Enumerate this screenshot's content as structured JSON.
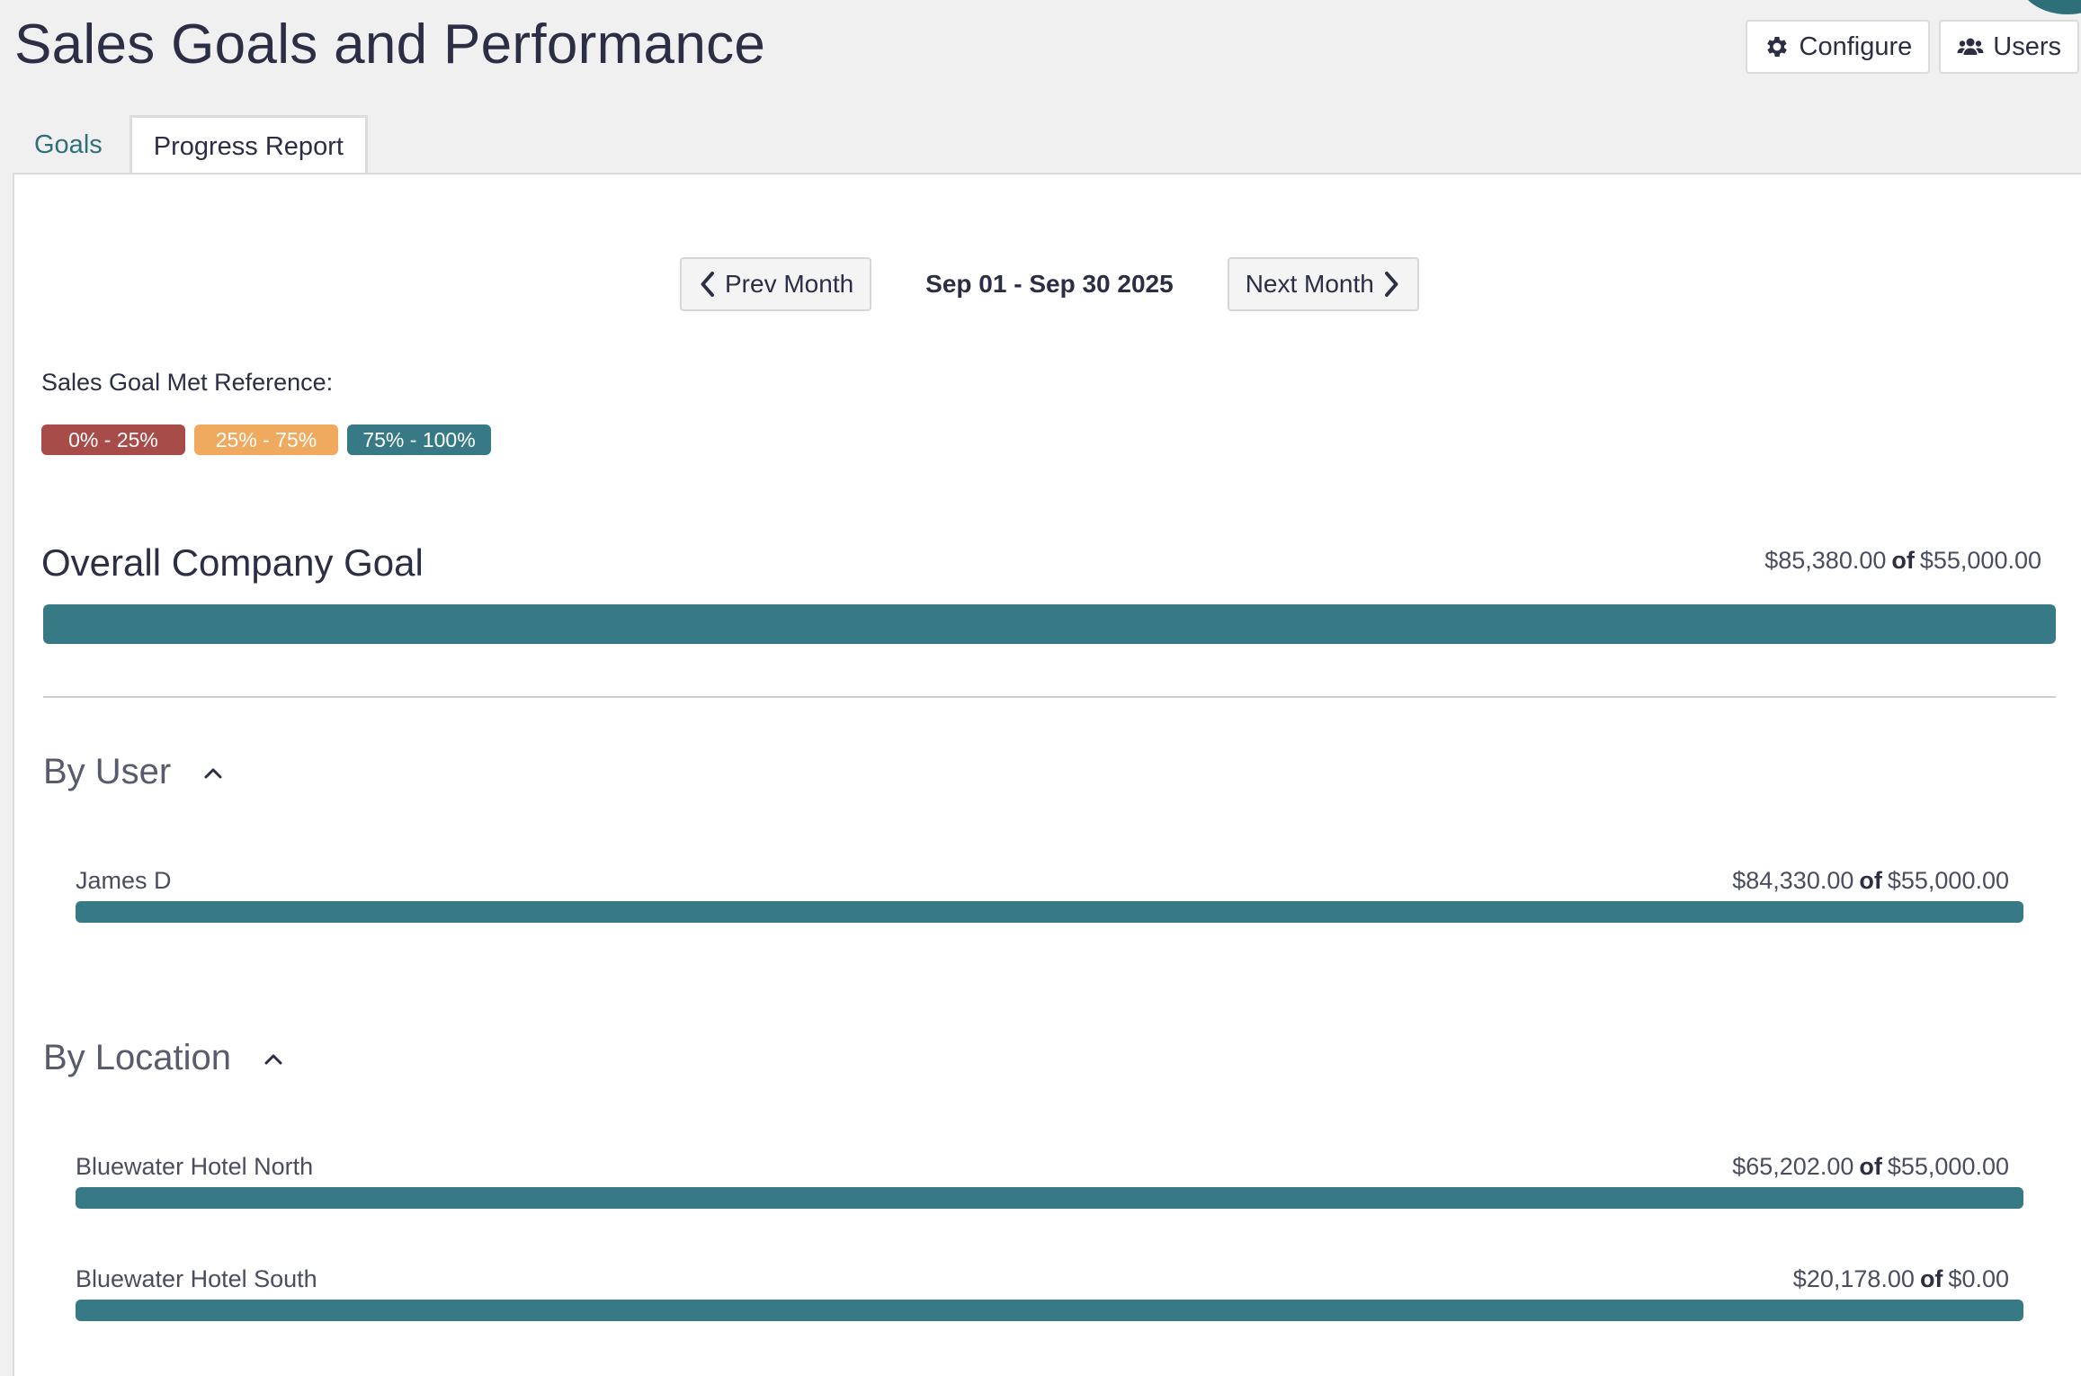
{
  "page": {
    "title": "Sales Goals and Performance"
  },
  "top_actions": {
    "configure_label": "Configure",
    "users_label": "Users"
  },
  "tabs": [
    {
      "label": "Goals",
      "active": false
    },
    {
      "label": "Progress Report",
      "active": true
    }
  ],
  "month_nav": {
    "prev_label": "Prev Month",
    "date_range": "Sep 01 - Sep 30 2025",
    "next_label": "Next Month"
  },
  "reference": {
    "label": "Sales Goal Met Reference:",
    "ranges": [
      {
        "label": "0% - 25%",
        "color": "#a84c4a"
      },
      {
        "label": "25% - 75%",
        "color": "#efaa60"
      },
      {
        "label": "75% - 100%",
        "color": "#377a85"
      }
    ]
  },
  "overall": {
    "title": "Overall Company Goal",
    "actual": "$85,380.00",
    "of": "of",
    "goal": "$55,000.00",
    "progress_percent": 100
  },
  "by_user": {
    "title": "By User",
    "rows": [
      {
        "name": "James D",
        "actual": "$84,330.00",
        "of": "of",
        "goal": "$55,000.00",
        "progress_percent": 100
      }
    ]
  },
  "by_location": {
    "title": "By Location",
    "rows": [
      {
        "name": "Bluewater Hotel North",
        "actual": "$65,202.00",
        "of": "of",
        "goal": "$55,000.00",
        "progress_percent": 100
      },
      {
        "name": "Bluewater Hotel South",
        "actual": "$20,178.00",
        "of": "of",
        "goal": "$0.00",
        "progress_percent": 100
      }
    ]
  },
  "colors": {
    "accent": "#377a85",
    "text": "#2b2e45",
    "link": "#2f6f7a"
  }
}
